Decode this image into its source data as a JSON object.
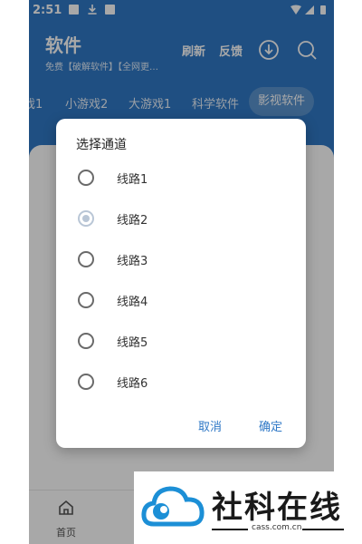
{
  "status_bar": {
    "time": "2:51"
  },
  "header": {
    "title": "软件",
    "subtitle": "免费【破解软件】【全网更…",
    "refresh_label": "刷新",
    "feedback_label": "反馈"
  },
  "tabs": [
    "戏1",
    "小游戏2",
    "大游戏1",
    "科学软件",
    "影视软件"
  ],
  "selected_tab": "影视软件",
  "bottom_nav": {
    "home_label": "首页"
  },
  "dialog": {
    "title": "选择通道",
    "options": [
      "线路1",
      "线路2",
      "线路3",
      "线路4",
      "线路5",
      "线路6"
    ],
    "selected_option": "线路2",
    "cancel_label": "取消",
    "ok_label": "确定"
  },
  "watermark": {
    "name": "社科在线",
    "domain": "cass.com.cn"
  },
  "colors": {
    "primary": "#2f78c6",
    "selected_tab_bg": "#5a93cf",
    "radio_checked": "#b9c6d6"
  },
  "icons": [
    "download-icon",
    "search-icon",
    "home-icon",
    "image-icon",
    "download-arrow-icon",
    "wifi-icon",
    "signal-icon",
    "battery-icon"
  ]
}
